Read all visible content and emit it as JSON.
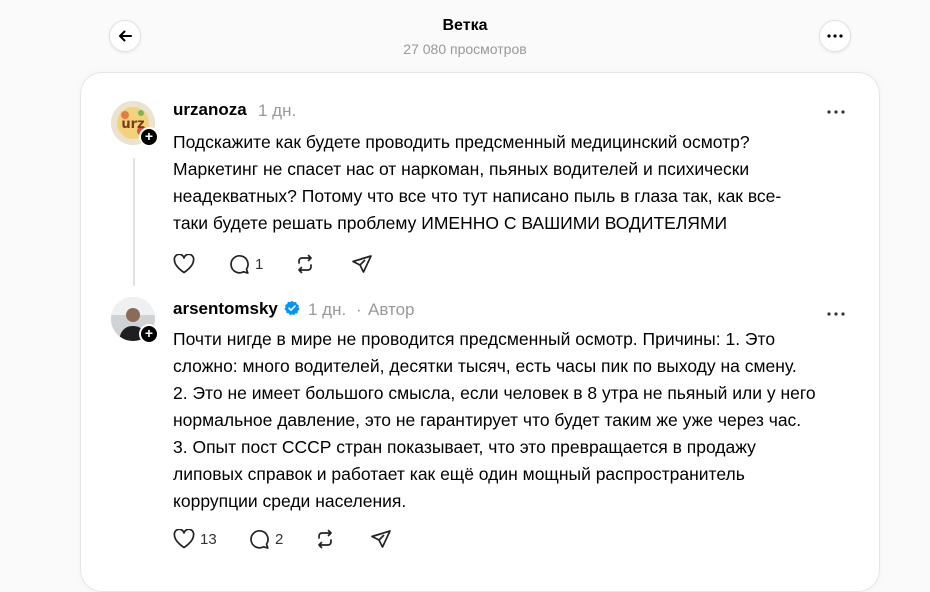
{
  "header": {
    "title": "Ветка",
    "views": "27 080 просмотров",
    "back_icon": "arrow-left-icon",
    "more_icon": "more-horizontal-icon"
  },
  "posts": [
    {
      "username": "urzanoza",
      "time": "1 дн.",
      "verified": false,
      "author_tag": "",
      "avatar_text": "urz",
      "lines": [
        "Подскажите как будете проводить предсменный медицинский осмотр?",
        "Маркетинг не спасет нас от наркоман, пьяных водителей и психически",
        "неадекватных? Потому что все что тут написано пыль в глаза так, как все-",
        "таки будете решать проблему ИМЕННО С ВАШИМИ ВОДИТЕЛЯМИ"
      ],
      "likes": "",
      "replies": "1",
      "reposts": "",
      "shares": ""
    },
    {
      "username": "arsentomsky",
      "time": "1 дн.",
      "verified": true,
      "separator": "·",
      "author_tag": "Автор",
      "lines": [
        "Почти нигде в мире не проводится предсменный осмотр. Причины: 1. Это",
        "сложно: много водителей, десятки тысяч, есть часы пик по выходу на смену.",
        "2. Это не имеет большого смысла, если человек в 8 утра не пьяный или у него",
        "нормальное давление, это не гарантирует что будет таким же уже через час.",
        "3. Опыт пост СССР стран показывает, что это превращается в продажу",
        "липовых справок и работает как ещё один мощный распространитель",
        "коррупции среди населения."
      ],
      "likes": "13",
      "replies": "2",
      "reposts": "",
      "shares": ""
    }
  ],
  "colors": {
    "background": "#fafafa",
    "card": "#ffffff",
    "muted_text": "#999999",
    "verified": "#0095f6"
  }
}
